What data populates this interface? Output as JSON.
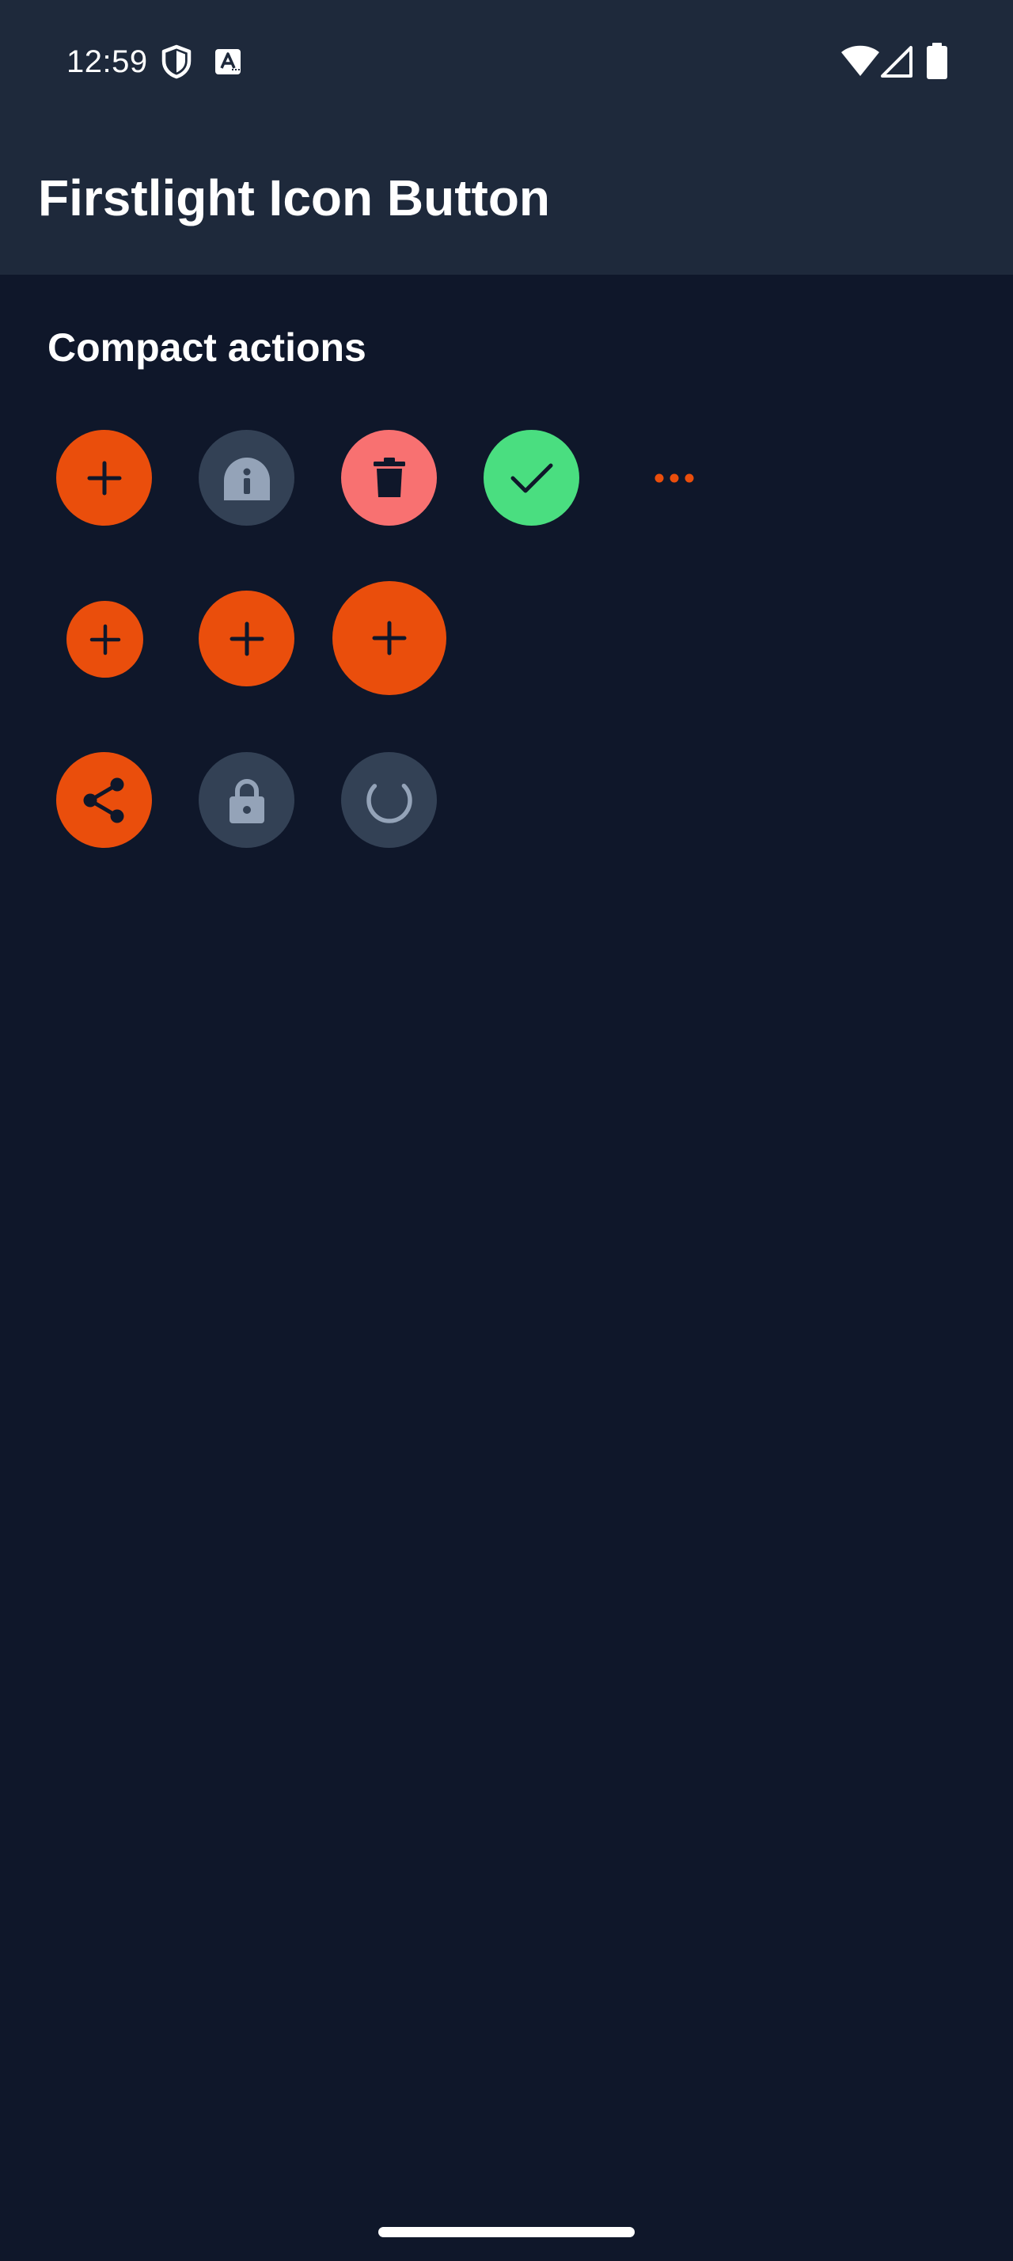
{
  "status_bar": {
    "time": "12:59",
    "icons": [
      "shield-icon",
      "text-a-icon",
      "wifi-icon",
      "signal-icon",
      "battery-icon"
    ]
  },
  "app_bar": {
    "title": "Firstlight Icon Button"
  },
  "section": {
    "title": "Compact actions"
  },
  "colors": {
    "background": "#0f172a",
    "app_bar": "#1e293b",
    "primary": "#ea4e0c",
    "secondary": "#334155",
    "danger": "#f87171",
    "success": "#4ade80",
    "icon_dark": "#0f172a",
    "icon_muted": "#94a3b8"
  },
  "buttons": {
    "row1": [
      {
        "variant": "primary",
        "icon": "plus-icon"
      },
      {
        "variant": "secondary",
        "icon": "info-icon"
      },
      {
        "variant": "danger",
        "icon": "trash-icon"
      },
      {
        "variant": "success",
        "icon": "check-icon"
      },
      {
        "variant": "ghost",
        "icon": "more-horizontal-icon"
      }
    ],
    "row2": [
      {
        "size": "small",
        "icon": "plus-icon"
      },
      {
        "size": "medium",
        "icon": "plus-icon"
      },
      {
        "size": "large",
        "icon": "plus-icon"
      }
    ],
    "row3": [
      {
        "variant": "primary",
        "icon": "share-icon"
      },
      {
        "variant": "disabled",
        "icon": "lock-icon"
      },
      {
        "variant": "loading",
        "icon": "spinner-icon"
      }
    ]
  }
}
